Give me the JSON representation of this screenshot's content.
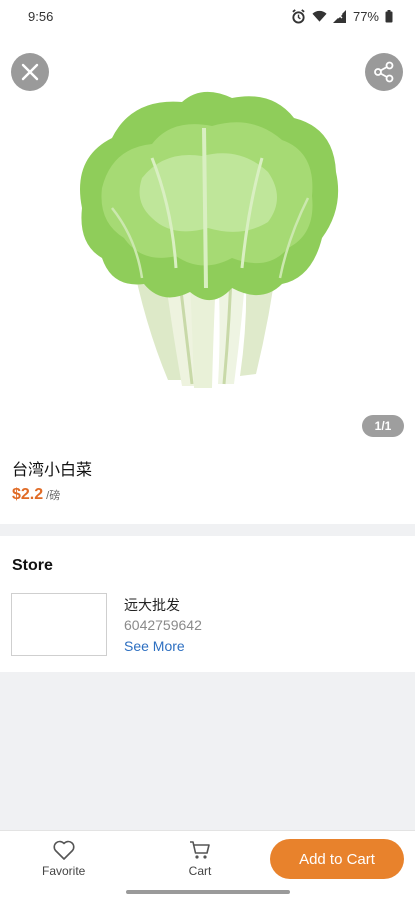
{
  "status_bar": {
    "time": "9:56",
    "battery": "77%",
    "icons": [
      "alarm-icon",
      "wifi-icon",
      "signal-icon",
      "battery-icon"
    ]
  },
  "hero": {
    "close_icon": "close-icon",
    "share_icon": "share-icon",
    "image_subject": "napa cabbage",
    "page_counter": "1/1"
  },
  "product": {
    "name": "台湾小白菜",
    "price": "$2.2",
    "unit": "/磅"
  },
  "store": {
    "section_title": "Store",
    "name": "远大批发",
    "phone": "6042759642",
    "see_more": "See More"
  },
  "bottom_bar": {
    "favorite_label": "Favorite",
    "cart_label": "Cart",
    "add_to_cart_label": "Add to Cart"
  },
  "colors": {
    "accent": "#e8822c",
    "price": "#e06b26",
    "link": "#2d6fc1"
  }
}
